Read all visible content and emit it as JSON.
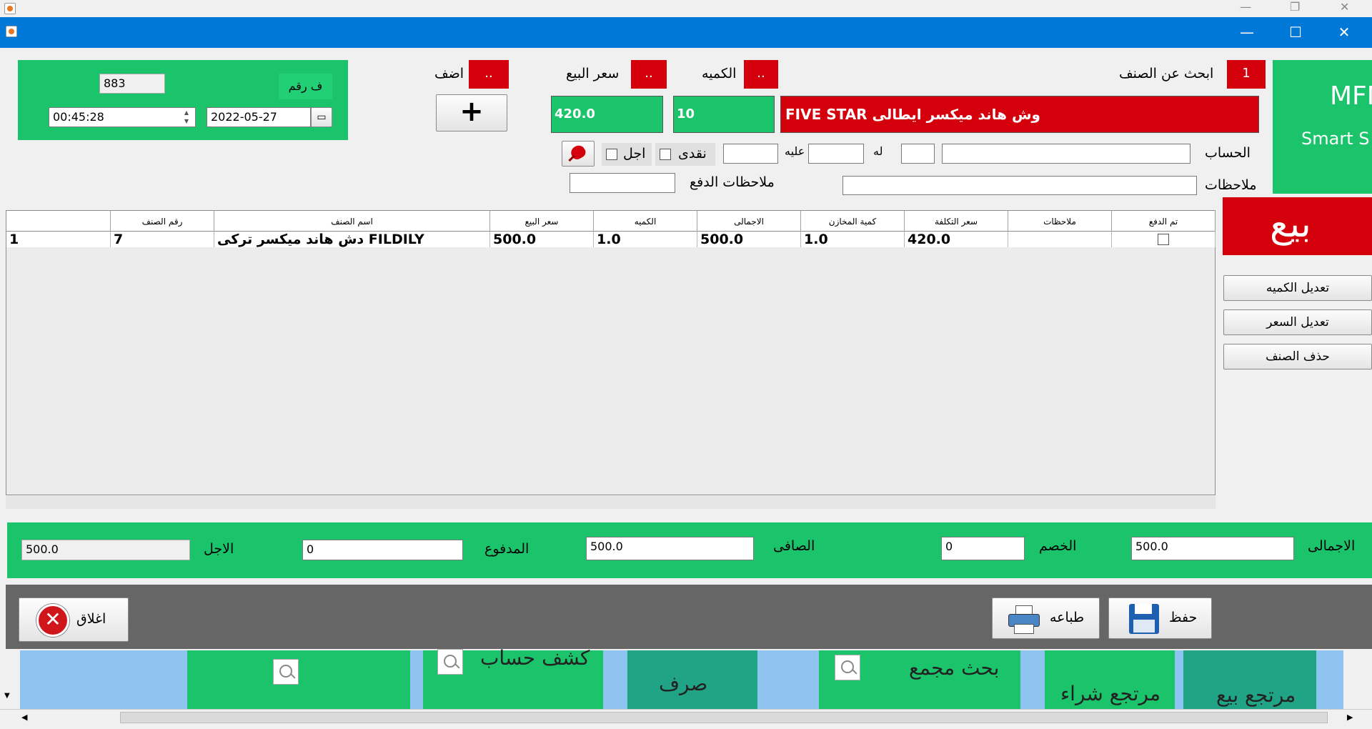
{
  "window": {
    "minimize": "—",
    "maximize": "☐",
    "close": "✕"
  },
  "invoice": {
    "label": "ف رقم",
    "number": "883",
    "date": "2022-05-27",
    "time": "00:45:28"
  },
  "entry": {
    "add_label": "اضف",
    "add_btn": "..",
    "price_label": "سعر البيع",
    "price_btn": "..",
    "qty_label": "الكميه",
    "qty_btn": "..",
    "search_label": "ابحث عن الصنف",
    "search_btn": "1",
    "price_value": "420.0",
    "qty_value": "10",
    "item_name": "FIVE STAR وش هاند ميكسر ايطالى",
    "plus": "+"
  },
  "account": {
    "label": "الحساب",
    "lah": "له",
    "alayh": "عليه",
    "cash": "نقدى",
    "credit": "اجل",
    "notes_label": "ملاحظات",
    "pay_notes_label": "ملاحظات الدفع"
  },
  "side": {
    "brand": "MFN",
    "brand_sub": "Smart S",
    "sell": "بيع",
    "edit_qty": "تعديل الكميه",
    "edit_price": "تعديل السعر",
    "delete_item": "حذف الصنف"
  },
  "table": {
    "columns": [
      "رقم الصنف",
      "اسم الصنف",
      "سعر البيع",
      "الكميه",
      "الاجمالى",
      "كمية المخازن",
      "سعر التكلفة",
      "ملاحظات",
      "تم الدفع"
    ],
    "rows": [
      {
        "idx": "1",
        "code": "7",
        "name": "دش هاند ميكسر تركى FILDILY",
        "price": "500.0",
        "qty": "1.0",
        "total": "500.0",
        "stock": "1.0",
        "cost": "420.0",
        "notes": ""
      }
    ]
  },
  "totals": {
    "total_label": "الاجمالى",
    "total": "500.0",
    "discount_label": "الخصم",
    "discount": "0",
    "net_label": "الصافى",
    "net": "500.0",
    "paid_label": "المدفوع",
    "paid": "0",
    "credit_label": "الاجل",
    "credit": "500.0"
  },
  "footer": {
    "close": "اغلاق",
    "print": "طباعه",
    "save": "حفظ"
  },
  "taskbar": {
    "account_statement": "كشف حساب",
    "expense": "صرف",
    "combined_search": "بحث مجمع",
    "purchase_return": "مرتجع شراء",
    "sale_return": "مرتجع بيع"
  }
}
